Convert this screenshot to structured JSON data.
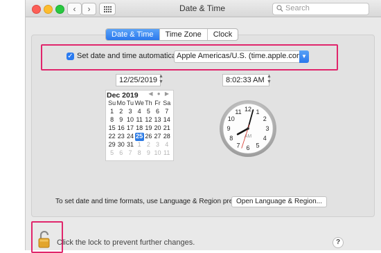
{
  "window": {
    "title": "Date & Time",
    "search_placeholder": "Search",
    "back_label": "‹",
    "forward_label": "›"
  },
  "tabs": [
    {
      "label": "Date & Time",
      "active": true
    },
    {
      "label": "Time Zone",
      "active": false
    },
    {
      "label": "Clock",
      "active": false
    }
  ],
  "auto": {
    "checked": true,
    "label": "Set date and time automatically:",
    "server": "Apple Americas/U.S. (time.apple.com.)"
  },
  "date_field": "12/25/2019",
  "time_field": "8:02:33 AM",
  "calendar": {
    "month": "Dec 2019",
    "day_names": [
      "Su",
      "Mo",
      "Tu",
      "We",
      "Th",
      "Fr",
      "Sa"
    ],
    "weeks": [
      [
        "1",
        "2",
        "3",
        "4",
        "5",
        "6",
        "7"
      ],
      [
        "8",
        "9",
        "10",
        "11",
        "12",
        "13",
        "14"
      ],
      [
        "15",
        "16",
        "17",
        "18",
        "19",
        "20",
        "21"
      ],
      [
        "22",
        "23",
        "24",
        "25",
        "26",
        "27",
        "28"
      ],
      [
        "29",
        "30",
        "31",
        "1",
        "2",
        "3",
        "4"
      ],
      [
        "5",
        "6",
        "7",
        "8",
        "9",
        "10",
        "11"
      ]
    ],
    "selected_day": "25"
  },
  "clock": {
    "hours": 8,
    "minutes": 2,
    "seconds": 33,
    "ampm": "AM",
    "numbers": [
      "12",
      "1",
      "2",
      "3",
      "4",
      "5",
      "6",
      "7",
      "8",
      "9",
      "10",
      "11"
    ]
  },
  "footer": {
    "info_text": "To set date and time formats, use Language & Region preferences.",
    "open_button": "Open Language & Region...",
    "lock_text": "Click the lock to prevent further changes.",
    "help": "?"
  },
  "colors": {
    "accent": "#2b78ec",
    "highlight": "#e0256b",
    "second_hand": "#d9433a"
  }
}
